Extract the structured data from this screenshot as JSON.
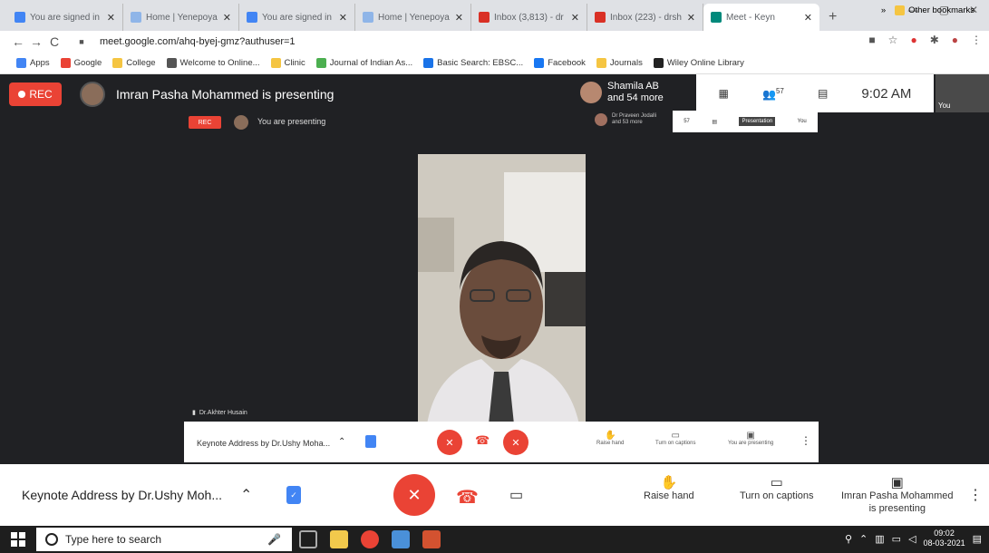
{
  "browser": {
    "tabs": [
      {
        "title": "You are signed in",
        "color": "#4285f4",
        "active": false
      },
      {
        "title": "Home | Yenepoya",
        "color": "#8fb5e8",
        "active": false
      },
      {
        "title": "You are signed in",
        "color": "#4285f4",
        "active": false
      },
      {
        "title": "Home | Yenepoya",
        "color": "#8fb5e8",
        "active": false
      },
      {
        "title": "Inbox (3,813) - dr",
        "color": "#d93025",
        "active": false
      },
      {
        "title": "Inbox (223) - drsh",
        "color": "#d93025",
        "active": false
      },
      {
        "title": "Meet - Keyn",
        "color": "#00897b",
        "active": true
      }
    ],
    "new_tab": "+",
    "url": "meet.google.com/ahq-byej-gmz?authuser=1",
    "bookmarks": [
      "Apps",
      "Google",
      "College",
      "Welcome to Online...",
      "Clinic",
      "Journal of Indian As...",
      "Basic Search: EBSC...",
      "Facebook",
      "Journals",
      "Wiley Online Library"
    ],
    "overflow": "»",
    "other_bookmarks": "Other bookmarks"
  },
  "meet": {
    "rec_label": "REC",
    "presenter_text": "Imran Pasha Mohammed is presenting",
    "participant_name": "Shamila AB",
    "participant_more": "and 54 more",
    "people_count": "57",
    "time": "9:02 AM",
    "corner_tile_label": "You",
    "inner": {
      "rec": "REC",
      "presenting": "You are presenting",
      "participant_name": "Dr Praveen Jodalli",
      "participant_more": "and 53 more",
      "strip_count": "57",
      "strip_tile": "Presentation",
      "strip_you": "You",
      "video_name": "Dr.Akhter Husain",
      "meeting_title": "Keynote Address by Dr.Ushy Moha...",
      "actions": [
        "Raise hand",
        "Turn on captions",
        "You are presenting"
      ]
    },
    "bottom": {
      "meeting_title": "Keynote Address by Dr.Ushy Moh...",
      "raise_hand": "Raise hand",
      "captions": "Turn on captions",
      "presenting_line1": "Imran Pasha Mohammed",
      "presenting_line2": "is presenting"
    }
  },
  "taskbar": {
    "search_placeholder": "Type here to search",
    "time": "09:02",
    "date": "08-03-2021"
  }
}
